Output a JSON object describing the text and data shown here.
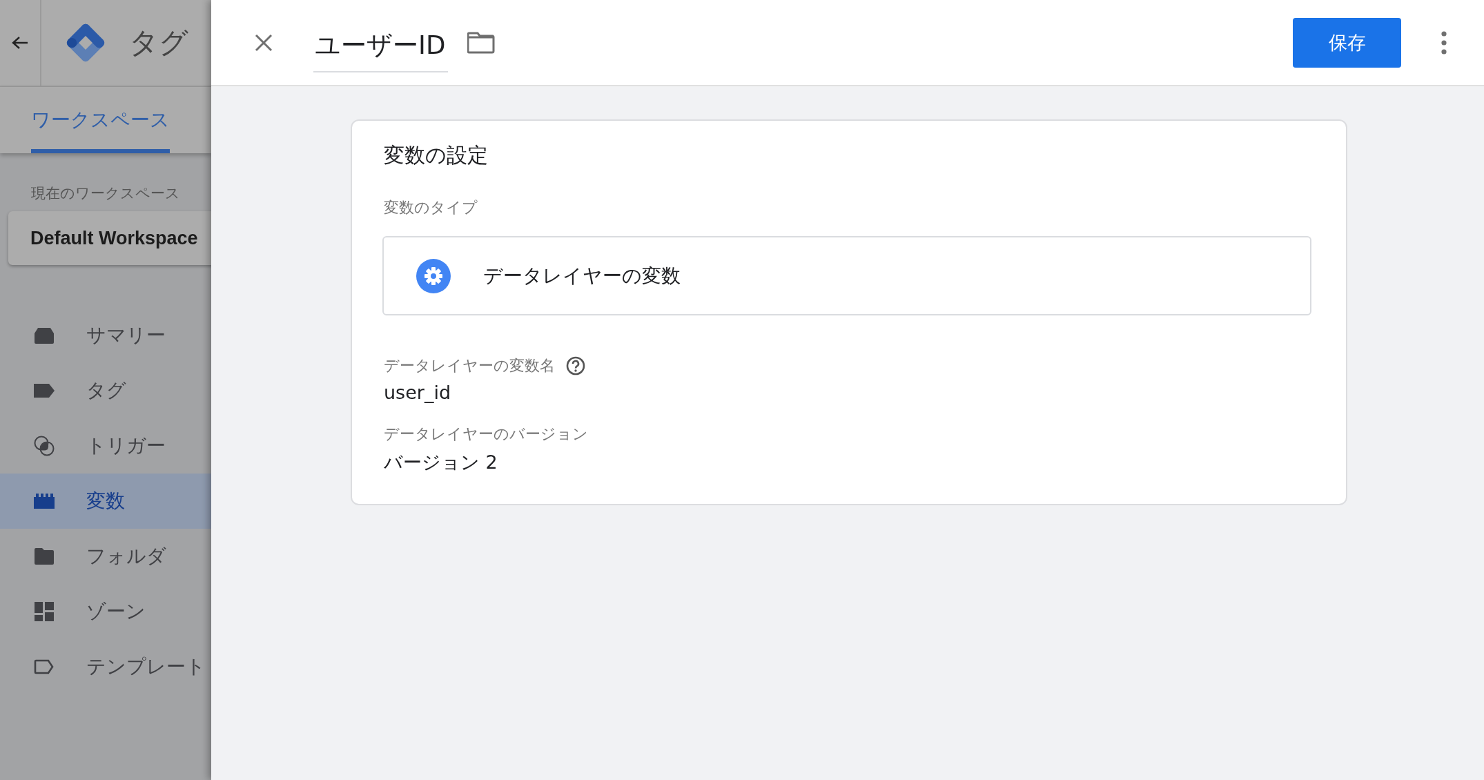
{
  "background_app": {
    "header": {
      "title": "タグ"
    },
    "tabs": [
      {
        "label": "ワークスペース",
        "selected": true
      }
    ],
    "workspace_label": "現在のワークスペース",
    "workspace": "Default Workspace",
    "nav": [
      {
        "label": "サマリー",
        "kind": "summary",
        "selected": false
      },
      {
        "label": "タグ",
        "kind": "tag",
        "selected": false
      },
      {
        "label": "トリガー",
        "kind": "trigger",
        "selected": false
      },
      {
        "label": "変数",
        "kind": "variable",
        "selected": true
      },
      {
        "label": "フォルダ",
        "kind": "folder",
        "selected": false
      },
      {
        "label": "ゾーン",
        "kind": "zone",
        "selected": false
      },
      {
        "label": "テンプレート",
        "kind": "template",
        "selected": false
      }
    ]
  },
  "editor": {
    "title": "ユーザーID",
    "save_button": "保存",
    "card": {
      "title": "変数の設定",
      "type_label": "変数のタイプ",
      "type_value": "データレイヤーの変数",
      "fields": [
        {
          "label": "データレイヤーの変数名",
          "help": true,
          "value": "user_id"
        },
        {
          "label": "データレイヤーのバージョン",
          "help": false,
          "value": "バージョン 2"
        }
      ]
    }
  }
}
